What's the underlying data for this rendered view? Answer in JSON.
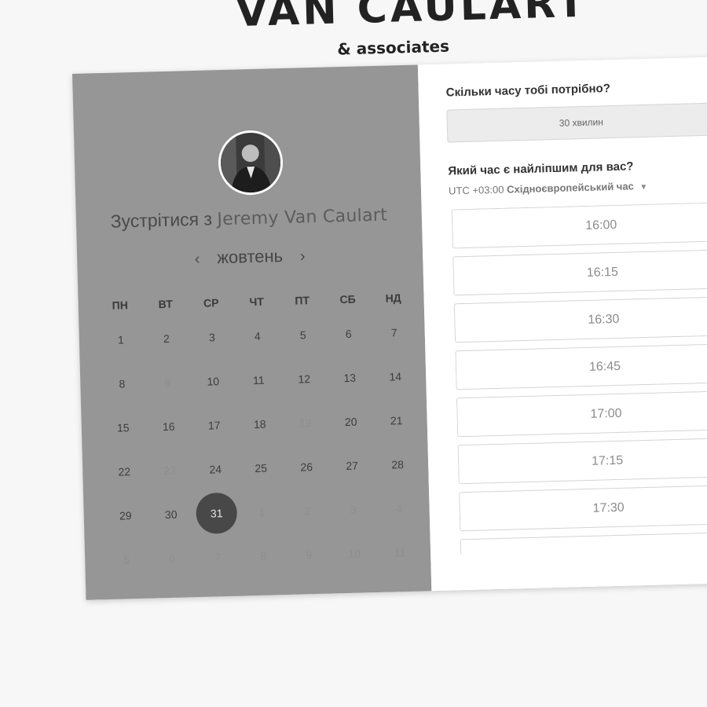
{
  "brand": {
    "title": "VAN CAULART",
    "subtitle": "& associates"
  },
  "calendar": {
    "meet_prefix": "Зустрітися з",
    "host_name": "Jeremy Van Caulart",
    "month": "жовтень",
    "prev_icon": "chevron-left-icon",
    "next_icon": "chevron-right-icon",
    "weekdays": [
      "ПН",
      "ВТ",
      "СР",
      "ЧТ",
      "ПТ",
      "СБ",
      "НД"
    ],
    "weeks": [
      [
        {
          "d": "1"
        },
        {
          "d": "2"
        },
        {
          "d": "3"
        },
        {
          "d": "4"
        },
        {
          "d": "5"
        },
        {
          "d": "6"
        },
        {
          "d": "7"
        }
      ],
      [
        {
          "d": "8"
        },
        {
          "d": "9",
          "faded": true
        },
        {
          "d": "10"
        },
        {
          "d": "11"
        },
        {
          "d": "12"
        },
        {
          "d": "13"
        },
        {
          "d": "14"
        }
      ],
      [
        {
          "d": "15"
        },
        {
          "d": "16"
        },
        {
          "d": "17"
        },
        {
          "d": "18"
        },
        {
          "d": "19",
          "faded": true
        },
        {
          "d": "20"
        },
        {
          "d": "21"
        }
      ],
      [
        {
          "d": "22"
        },
        {
          "d": "23",
          "faded": true
        },
        {
          "d": "24"
        },
        {
          "d": "25"
        },
        {
          "d": "26"
        },
        {
          "d": "27"
        },
        {
          "d": "28"
        }
      ],
      [
        {
          "d": "29"
        },
        {
          "d": "30"
        },
        {
          "d": "31",
          "selected": true
        },
        {
          "d": "1",
          "faded": true
        },
        {
          "d": "2",
          "faded": true
        },
        {
          "d": "3",
          "faded": true
        },
        {
          "d": "4",
          "faded": true
        }
      ],
      [
        {
          "d": "5",
          "faded": true
        },
        {
          "d": "6",
          "faded": true
        },
        {
          "d": "7",
          "faded": true
        },
        {
          "d": "8",
          "faded": true
        },
        {
          "d": "9",
          "faded": true
        },
        {
          "d": "10",
          "faded": true
        },
        {
          "d": "11",
          "faded": true
        }
      ]
    ]
  },
  "booking": {
    "duration_question": "Скільки часу тобі потрібно?",
    "duration_value": "30 хвилин",
    "time_question": "Який час є найліпшим для вас?",
    "timezone_offset": "UTC +03:00",
    "timezone_name": "Східноєвропейський час",
    "timezone_caret_icon": "caret-down-icon",
    "slots": [
      "16:00",
      "16:15",
      "16:30",
      "16:45",
      "17:00",
      "17:15",
      "17:30",
      ""
    ]
  }
}
